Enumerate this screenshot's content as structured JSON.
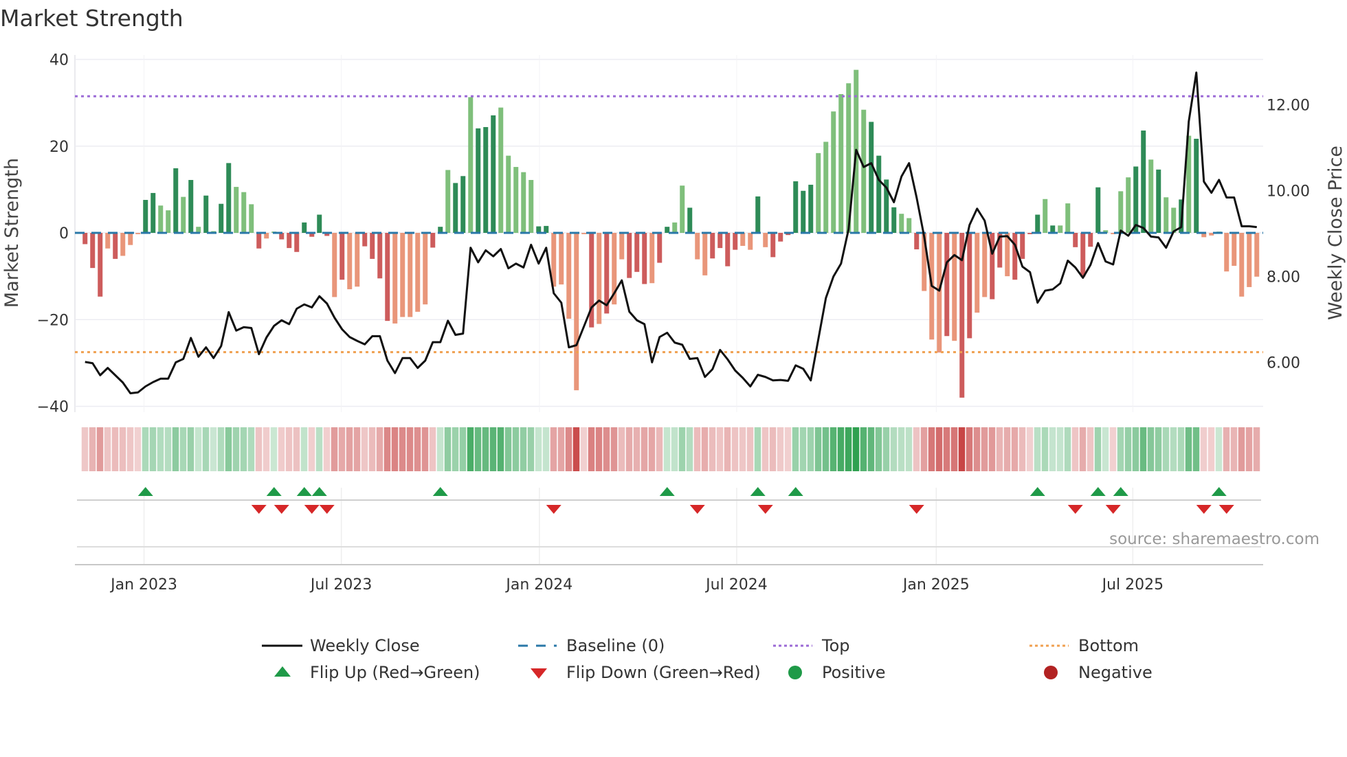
{
  "title": "Market Strength",
  "source": "source: sharemaestro.com",
  "chart_data": {
    "type": "bar",
    "title": "Market Strength",
    "x_start": "2022-11-06",
    "x_frequency": "weekly",
    "ylabel": "Market Strength",
    "y2label": "Weekly Close Price",
    "ylim": [
      -40,
      40
    ],
    "y2lim": [
      4.95,
      13.05
    ],
    "y_ticks": [
      "40",
      "20",
      "0",
      "−20",
      "−40"
    ],
    "y_tick_values": [
      40,
      20,
      0,
      -20,
      -40
    ],
    "y2_ticks": [
      "12.00",
      "10.00",
      "8.00",
      "6.00"
    ],
    "y2_tick_values": [
      12,
      10,
      8,
      6
    ],
    "x_ticks": [
      {
        "label": "Jan 2023",
        "week": 7.8
      },
      {
        "label": "Jul 2023",
        "week": 33.9
      },
      {
        "label": "Jan 2024",
        "week": 60.1
      },
      {
        "label": "Jul 2024",
        "week": 86.2
      },
      {
        "label": "Jan 2025",
        "week": 112.6
      },
      {
        "label": "Jul 2025",
        "week": 138.6
      }
    ],
    "top_level": 31.5,
    "bottom_level": -27.5,
    "baseline": 0,
    "strength": [
      -2.6,
      -8.1,
      -14.7,
      -3.6,
      -6.0,
      -5.3,
      -2.8,
      -0.3,
      7.6,
      9.2,
      6.3,
      5.2,
      14.9,
      8.3,
      12.2,
      1.4,
      8.6,
      0.4,
      6.7,
      16.1,
      10.6,
      9.4,
      6.6,
      -3.6,
      -1.3,
      0.3,
      -1.5,
      -3.5,
      -4.4,
      2.4,
      -0.9,
      4.2,
      -0.7,
      -14.8,
      -10.8,
      -13.0,
      -12.4,
      -3.1,
      -6.0,
      -10.5,
      -20.3,
      -20.9,
      -19.4,
      -19.4,
      -18.2,
      -16.5,
      -3.4,
      1.4,
      14.5,
      11.5,
      13.1,
      31.3,
      24.1,
      24.4,
      27.1,
      28.9,
      17.8,
      15.2,
      14.0,
      12.2,
      1.5,
      1.6,
      -12.4,
      -11.9,
      -19.8,
      -36.3,
      -0.3,
      -21.8,
      -21.0,
      -18.6,
      -16.5,
      -6.1,
      -10.4,
      -9.0,
      -11.8,
      -11.6,
      -6.9,
      1.4,
      2.4,
      10.9,
      5.8,
      -6.1,
      -9.8,
      -5.9,
      -3.5,
      -7.7,
      -3.9,
      -3.0,
      -3.9,
      8.4,
      -3.3,
      -5.6,
      -2.0,
      -0.5,
      11.9,
      9.7,
      11.1,
      18.4,
      21.0,
      28.0,
      32.0,
      34.5,
      37.6,
      28.4,
      25.6,
      17.8,
      12.3,
      5.9,
      4.4,
      3.4,
      -3.8,
      -13.4,
      -24.6,
      -27.6,
      -23.8,
      -24.9,
      -38.0,
      -24.3,
      -18.4,
      -14.8,
      -15.3,
      -8.0,
      -10.0,
      -10.8,
      -6.0,
      -0.3,
      4.2,
      7.8,
      1.7,
      1.7,
      6.8,
      -3.3,
      -10.1,
      -3.2,
      10.5,
      0.6,
      -0.3,
      9.6,
      12.8,
      15.3,
      23.6,
      16.9,
      14.6,
      8.2,
      5.8,
      7.7,
      22.4,
      21.7,
      -1.0,
      -0.6,
      0.3,
      -8.9,
      -7.6,
      -14.7,
      -12.5,
      -10.1
    ],
    "strength_shade": "dddldllldd",
    "strength_shade_rest": "lldldldlddllldlldddddddldllddddlllllddlddldddlllllddllllldldllddd lddlldllddddlldlddddddlllllllddddlldllldlddllddlddddldllddddllllddldlldldll",
    "close": [
      6.01,
      5.98,
      5.7,
      5.87,
      5.7,
      5.53,
      5.28,
      5.3,
      5.44,
      5.54,
      5.62,
      5.62,
      6.0,
      6.08,
      6.57,
      6.13,
      6.35,
      6.1,
      6.38,
      7.17,
      6.74,
      6.82,
      6.8,
      6.19,
      6.58,
      6.85,
      6.98,
      6.89,
      7.25,
      7.35,
      7.28,
      7.54,
      7.37,
      7.04,
      6.77,
      6.59,
      6.5,
      6.42,
      6.61,
      6.61,
      6.04,
      5.75,
      6.1,
      6.1,
      5.87,
      6.04,
      6.47,
      6.47,
      6.97,
      6.64,
      6.67,
      8.67,
      8.33,
      8.61,
      8.47,
      8.64,
      8.19,
      8.3,
      8.21,
      8.74,
      8.3,
      8.67,
      7.61,
      7.39,
      6.35,
      6.4,
      6.84,
      7.28,
      7.44,
      7.33,
      7.61,
      7.91,
      7.18,
      6.98,
      6.89,
      6.0,
      6.59,
      6.69,
      6.46,
      6.41,
      6.08,
      6.1,
      5.66,
      5.84,
      6.29,
      6.07,
      5.81,
      5.64,
      5.44,
      5.71,
      5.66,
      5.58,
      5.59,
      5.57,
      5.93,
      5.85,
      5.58,
      6.54,
      7.5,
      8.0,
      8.3,
      9.1,
      10.95,
      10.55,
      10.64,
      10.25,
      10.07,
      9.73,
      10.33,
      10.64,
      9.84,
      8.93,
      7.78,
      7.67,
      8.33,
      8.5,
      8.38,
      9.2,
      9.58,
      9.3,
      8.53,
      8.93,
      8.94,
      8.74,
      8.23,
      8.1,
      7.39,
      7.67,
      7.7,
      7.84,
      8.37,
      8.21,
      7.97,
      8.27,
      8.78,
      8.35,
      8.28,
      9.07,
      8.95,
      9.2,
      9.13,
      8.93,
      8.91,
      8.67,
      9.05,
      9.15,
      11.61,
      12.75,
      10.21,
      9.95,
      10.25,
      9.84,
      9.84,
      9.17,
      9.17,
      9.15
    ],
    "flip_up_weeks": [
      8,
      25,
      29,
      31,
      47,
      77,
      89,
      94,
      126,
      134,
      137,
      150
    ],
    "flip_down_weeks": [
      23,
      26,
      30,
      32,
      62,
      81,
      90,
      110,
      131,
      136,
      148,
      151
    ],
    "colors": {
      "positive_strong": "#2e8b57",
      "positive_weak": "#7fbf7b",
      "negative_strong": "#cd5c5c",
      "negative_weak": "#e9967a",
      "baseline": "#2a78a8",
      "top": "#9b6ad6",
      "bottom": "#f0a050",
      "flip_up": "#1f9a48",
      "flip_down": "#d62728",
      "close": "#111111",
      "negative_marker": "#b22222"
    },
    "legend": {
      "placement": "bottom",
      "items": [
        "Weekly Close",
        "Baseline (0)",
        "Top",
        "Bottom",
        "Flip Up (Red→Green)",
        "Flip Down (Green→Red)",
        "Positive",
        "Negative"
      ]
    }
  }
}
